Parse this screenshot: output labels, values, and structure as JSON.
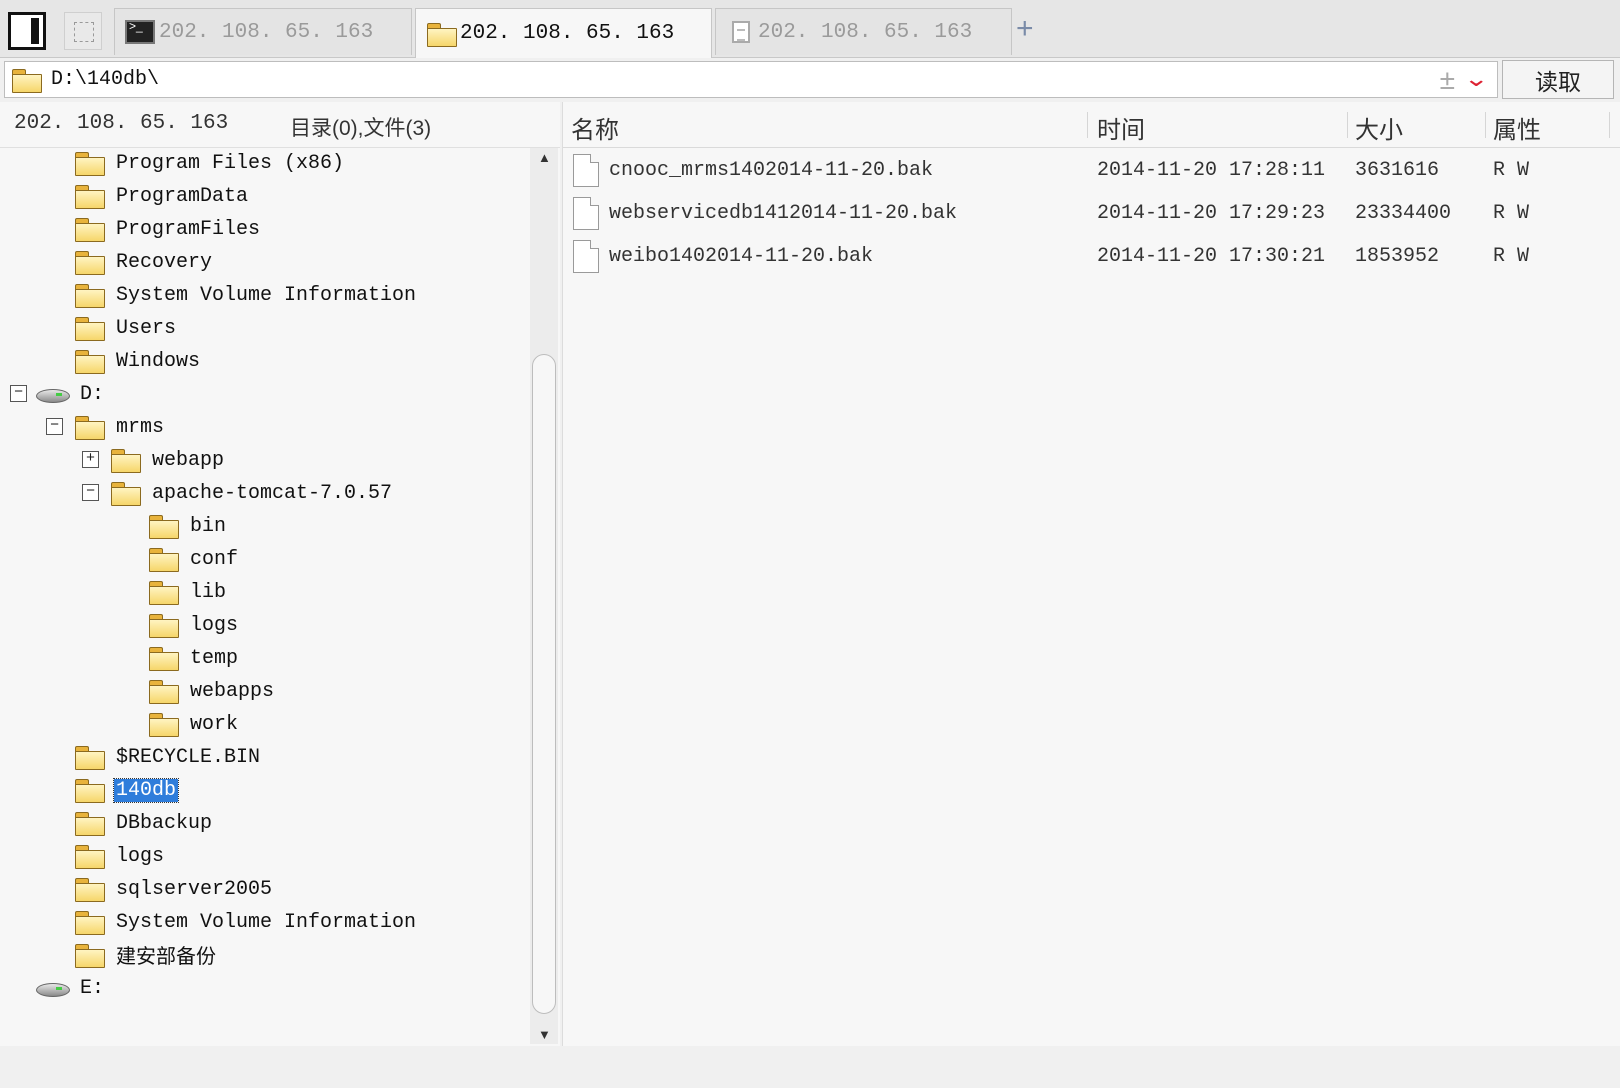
{
  "tabs": [
    {
      "label": "202. 108. 65. 163",
      "icon": "terminal-icon",
      "active": false
    },
    {
      "label": "202. 108. 65. 163",
      "icon": "folder-icon",
      "active": true
    },
    {
      "label": "202. 108. 65. 163",
      "icon": "document-icon",
      "active": false
    }
  ],
  "add_tab_label": "+",
  "address": {
    "path": "D:\\140db\\",
    "read_button": "读取"
  },
  "left_pane": {
    "host": "202. 108. 65. 163",
    "counts": "目录(0),文件(3)",
    "tree": [
      {
        "label": "Program Files (x86)",
        "type": "folder",
        "expander": ""
      },
      {
        "label": "ProgramData",
        "type": "folder",
        "expander": ""
      },
      {
        "label": "ProgramFiles",
        "type": "folder",
        "expander": ""
      },
      {
        "label": "Recovery",
        "type": "folder",
        "expander": ""
      },
      {
        "label": "System Volume Information",
        "type": "folder",
        "expander": ""
      },
      {
        "label": "Users",
        "type": "folder",
        "expander": ""
      },
      {
        "label": "Windows",
        "type": "folder",
        "expander": ""
      },
      {
        "label": "D:",
        "type": "drive",
        "expander": "−"
      },
      {
        "label": "mrms",
        "type": "folder",
        "expander": "−"
      },
      {
        "label": "webapp",
        "type": "folder",
        "expander": "+"
      },
      {
        "label": "apache-tomcat-7.0.57",
        "type": "folder",
        "expander": "−"
      },
      {
        "label": "bin",
        "type": "folder",
        "expander": ""
      },
      {
        "label": "conf",
        "type": "folder",
        "expander": ""
      },
      {
        "label": "lib",
        "type": "folder",
        "expander": ""
      },
      {
        "label": "logs",
        "type": "folder",
        "expander": ""
      },
      {
        "label": "temp",
        "type": "folder",
        "expander": ""
      },
      {
        "label": "webapps",
        "type": "folder",
        "expander": ""
      },
      {
        "label": "work",
        "type": "folder",
        "expander": ""
      },
      {
        "label": "$RECYCLE.BIN",
        "type": "folder",
        "expander": ""
      },
      {
        "label": "140db",
        "type": "folder",
        "expander": "",
        "selected": true
      },
      {
        "label": "DBbackup",
        "type": "folder",
        "expander": ""
      },
      {
        "label": "logs",
        "type": "folder",
        "expander": ""
      },
      {
        "label": "sqlserver2005",
        "type": "folder",
        "expander": ""
      },
      {
        "label": "System Volume Information",
        "type": "folder",
        "expander": ""
      },
      {
        "label": "建安部备份",
        "type": "folder",
        "expander": ""
      },
      {
        "label": "E:",
        "type": "drive",
        "expander": ""
      }
    ]
  },
  "file_list": {
    "columns": [
      "名称",
      "时间",
      "大小",
      "属性"
    ],
    "rows": [
      {
        "name": "cnooc_mrms1402014-11-20.bak",
        "time": "2014-11-20 17:28:11",
        "size": "3631616",
        "attr": "R W"
      },
      {
        "name": "webservicedb1412014-11-20.bak",
        "time": "2014-11-20 17:29:23",
        "size": "23334400",
        "attr": "R W"
      },
      {
        "name": "weibo1402014-11-20.bak",
        "time": "2014-11-20 17:30:21",
        "size": "1853952",
        "attr": "R W"
      }
    ]
  },
  "colors": {
    "selection": "#2f7ddb",
    "folder": "#f6d66a",
    "dropdown_arrow": "#dd2233"
  }
}
